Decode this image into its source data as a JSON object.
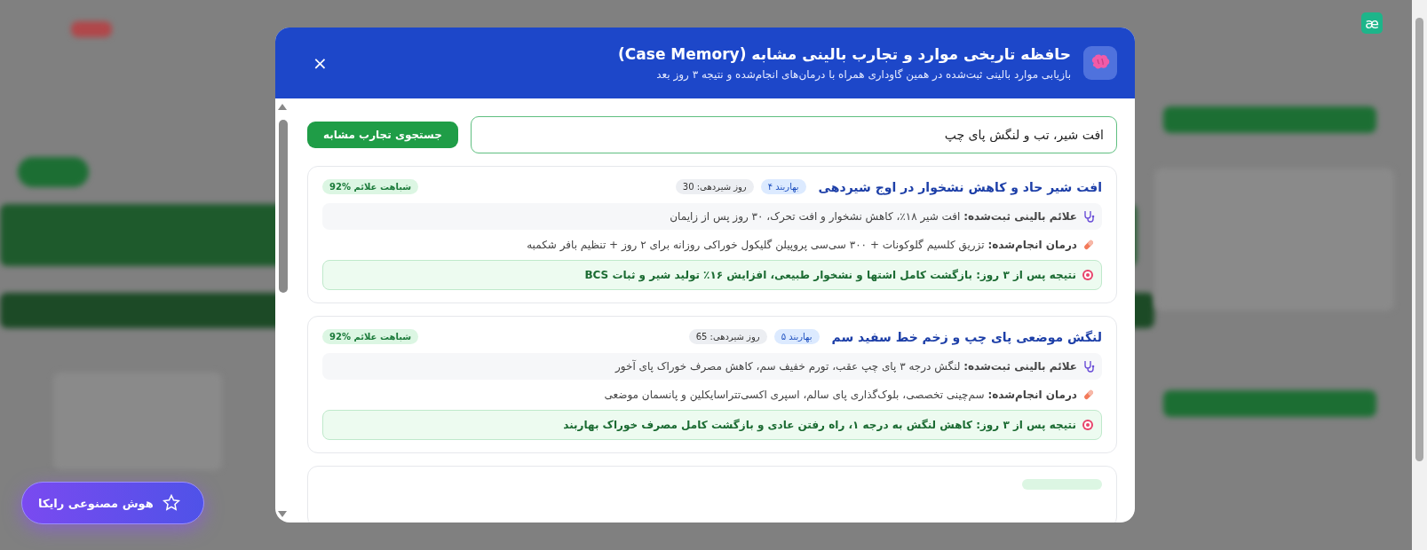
{
  "app_logo": "æ",
  "dialog": {
    "title": "حافظه تاریخی موارد و تجارب بالینی مشابه (Case Memory)",
    "subtitle": "بازیابی موارد بالینی ثبت‌شده در همین گاوداری همراه با درمان‌های انجام‌شده و نتیجه ۳ روز بعد",
    "close": "×",
    "search": {
      "value": "افت شیر، تب و لنگش پای چپ",
      "button": "جستجوی تجارب مشابه"
    },
    "cases": [
      {
        "title": "افت شیر حاد و کاهش نشخوار در اوج شیردهی",
        "pen": "بهاربند ۴",
        "days": "روز شیردهی: 30",
        "similarity": "شباهت علائم %92",
        "symptoms": "**علائم بالینی ثبت‌شده:** افت شیر ۱۸٪، کاهش نشخوار و افت تحرک، ۳۰ روز پس از زایمان",
        "treatment": "**درمان انجام‌شده:** تزریق کلسیم گلوکونات + ۳۰۰ سی‌سی پروپیلن گلیکول خوراکی روزانه برای ۲ روز + تنظیم بافر شکمبه",
        "outcome": "نتیجه پس از ۳ روز: بازگشت کامل اشتها و نشخوار طبیعی، افزایش ۱۶٪ تولید شیر و ثبات BCS"
      },
      {
        "title": "لنگش موضعی پای چپ و زخم خط سفید سم",
        "pen": "بهاربند ۵",
        "days": "روز شیردهی: 65",
        "similarity": "شباهت علائم %92",
        "symptoms": "**علائم بالینی ثبت‌شده:** لنگش درجه ۳ پای چپ عقب، تورم خفیف سم، کاهش مصرف خوراک پای آخور",
        "treatment": "**درمان انجام‌شده:** سم‌چینی تخصصی، بلوک‌گذاری پای سالم، اسپری اکسی‌تتراسایکلین و پانسمان موضعی",
        "outcome": "نتیجه پس از ۳ روز: کاهش لنگش به درجه ۱، راه رفتن عادی و بازگشت کامل مصرف خوراک بهاربند"
      }
    ]
  },
  "assistant_button": "هوش مصنوعی رایکا"
}
